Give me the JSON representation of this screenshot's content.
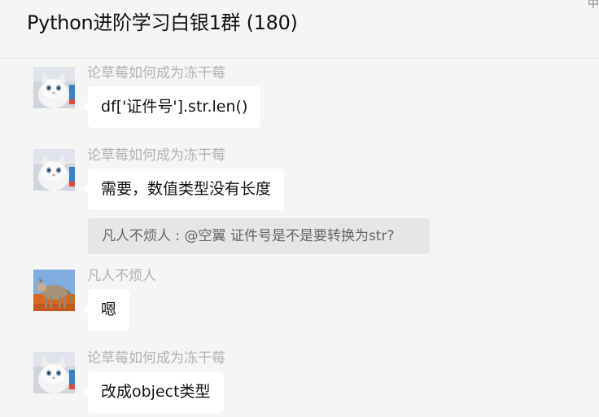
{
  "chat": {
    "title": "Python进阶学习白银1群 (180)",
    "corner_glyph": "中"
  },
  "messages": [
    {
      "sender": "论草莓如何成为冻干莓",
      "text": "df['证件号'].str.len()",
      "avatar": "cat-avatar"
    },
    {
      "sender": "论草莓如何成为冻干莓",
      "text": "需要，数值类型没有长度",
      "avatar": "cat-avatar",
      "quote": "凡人不烦人 : @空翼 证件号是不是要转换为str?"
    },
    {
      "sender": "凡人不烦人",
      "text": "嗯",
      "avatar": "wolf-avatar"
    },
    {
      "sender": "论草莓如何成为冻干莓",
      "text": "改成object类型",
      "avatar": "cat-avatar"
    }
  ]
}
